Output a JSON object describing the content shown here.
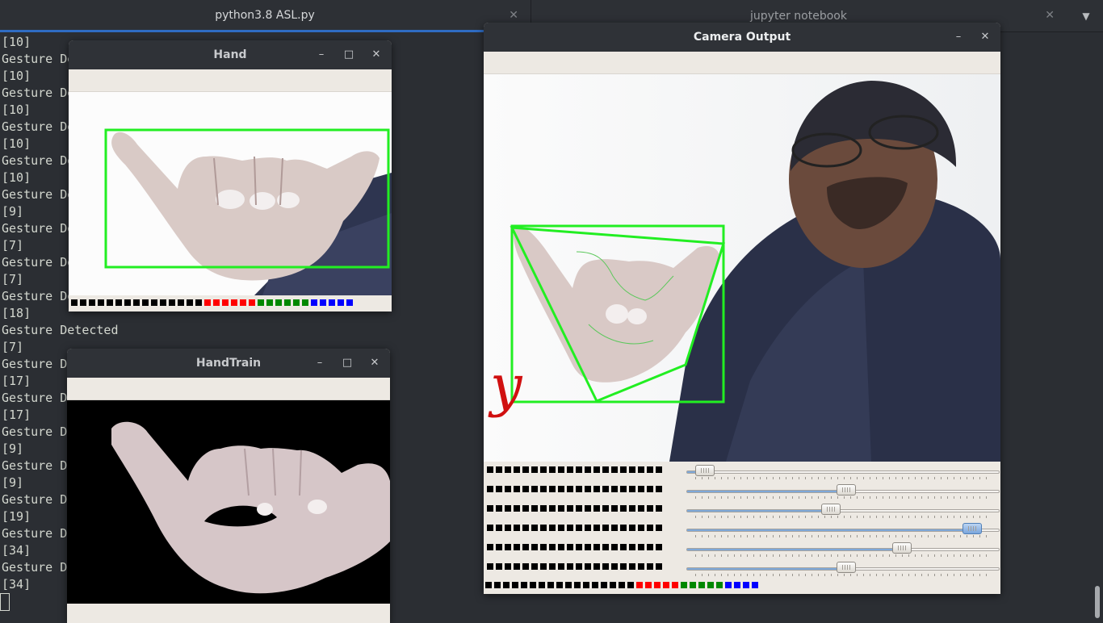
{
  "tabs": [
    {
      "label": "python3.8 ASL.py",
      "active": true
    },
    {
      "label": "jupyter notebook",
      "active": false
    }
  ],
  "terminal_lines": [
    "[10]",
    "Gesture Detected",
    "[10]",
    "Gesture Detected",
    "[10]",
    "Gesture Detected",
    "[10]",
    "Gesture Detected",
    "[10]",
    "Gesture Detected",
    "[9]",
    "Gesture Detected",
    "[7]",
    "Gesture Detected",
    "[7]",
    "Gesture Detected",
    "[18]",
    "Gesture Detected",
    "[7]",
    "Gesture Detected",
    "[17]",
    "Gesture Detected",
    "[17]",
    "Gesture Detected",
    "[9]",
    "Gesture Detected",
    "[9]",
    "Gesture Detected",
    "[19]",
    "Gesture Detected",
    "[34]",
    "Gesture Detected",
    "[34]"
  ],
  "windows": {
    "hand": {
      "title": "Hand"
    },
    "handtrain": {
      "title": "HandTrain"
    },
    "camera": {
      "title": "Camera Output",
      "overlay_letter": "y"
    }
  },
  "sliders": [
    {
      "value": 0.03
    },
    {
      "value": 0.51
    },
    {
      "value": 0.46
    },
    {
      "value": 0.94
    },
    {
      "value": 0.7
    },
    {
      "value": 0.51
    }
  ],
  "colors": {
    "detection_box": "#22ee22",
    "overlay_letter": "#d01010",
    "tab_underline": "#2f6cc3"
  },
  "icons": {
    "minimize": "minimize-icon",
    "maximize": "maximize-icon",
    "close": "close-icon"
  }
}
